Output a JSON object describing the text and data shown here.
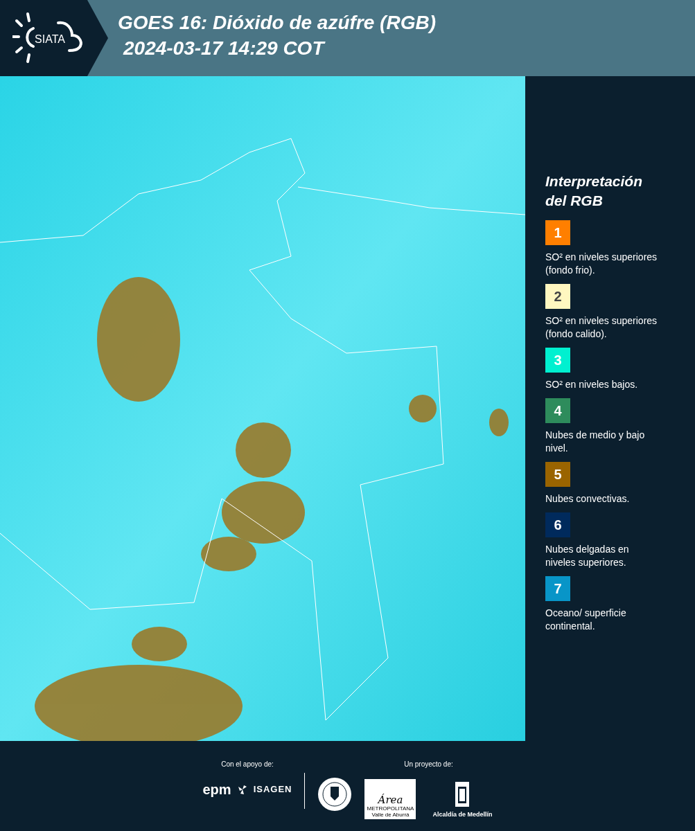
{
  "header": {
    "logo_text": "SIATA",
    "title": "GOES 16: Dióxido de azúfre (RGB)",
    "subtitle": "2024-03-17 14:29 COT"
  },
  "legend": {
    "title": "Interpretación del RGB",
    "items": [
      {
        "number": "1",
        "color": "#ff7f00",
        "text": "SO² en niveles superiores (fondo frio)."
      },
      {
        "number": "2",
        "color": "#fff7c0",
        "text": "SO² en niveles superiores (fondo calido)."
      },
      {
        "number": "3",
        "color": "#00f0d0",
        "text": "SO² en niveles bajos."
      },
      {
        "number": "4",
        "color": "#2e8c5c",
        "text": "Nubes de medio y bajo nivel."
      },
      {
        "number": "5",
        "color": "#9a6400",
        "text": "Nubes convectivas."
      },
      {
        "number": "6",
        "color": "#002a5c",
        "text": "Nubes delgadas en niveles superiores."
      },
      {
        "number": "7",
        "color": "#0895c8",
        "text": "Oceano/ superficie continental."
      }
    ]
  },
  "footer": {
    "support_label": "Con el apoyo de:",
    "support_logos": [
      "epm",
      "ISAGEN"
    ],
    "project_label": "Un proyecto de:",
    "area_logo": {
      "script": "Área",
      "line1": "METROPOLITANA",
      "line2": "Valle de Aburrá"
    },
    "alcaldia": "Alcaldía de Medellín"
  }
}
